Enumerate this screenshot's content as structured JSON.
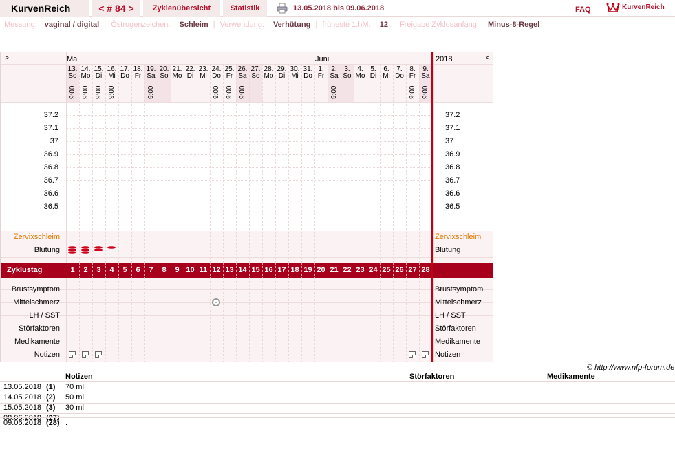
{
  "header": {
    "app_name": "KurvenReich",
    "cycle_label": "< # 84 >",
    "tab_overview": "Zyklenübersicht",
    "tab_statistics": "Statistik",
    "date_range": "13.05.2018 bis 09.06.2018",
    "faq": "FAQ",
    "logo_text": "KurvenReich"
  },
  "info": {
    "messung_label": "Messung:",
    "messung_value": "vaginal / digital",
    "oestrogen_label": "Östrogenzeichen:",
    "oestrogen_value": "Schleim",
    "verwendung_label": "Verwendung:",
    "verwendung_value": "Verhütung",
    "frueheste_label": "früheste 1.hM:",
    "frueheste_value": "12",
    "freigabe_label": "Freigabe Zyklusanfang:",
    "freigabe_value": "Minus-8-Regel"
  },
  "chart": {
    "nav_prev": ">",
    "nav_next": "<",
    "month_may": "Mai",
    "month_june": "Juni",
    "year": "2018",
    "days": [
      {
        "d": "13.",
        "w": "So",
        "t": "9:00",
        "we": true
      },
      {
        "d": "14.",
        "w": "Mo",
        "t": "9:00",
        "we": false
      },
      {
        "d": "15.",
        "w": "Di",
        "t": "9:00",
        "we": false
      },
      {
        "d": "16.",
        "w": "Mi",
        "t": "9:00",
        "we": false
      },
      {
        "d": "17.",
        "w": "Do",
        "t": "",
        "we": false
      },
      {
        "d": "18.",
        "w": "Fr",
        "t": "",
        "we": false
      },
      {
        "d": "19.",
        "w": "Sa",
        "t": "9:00",
        "we": true
      },
      {
        "d": "20.",
        "w": "So",
        "t": "",
        "we": true
      },
      {
        "d": "21.",
        "w": "Mo",
        "t": "",
        "we": false
      },
      {
        "d": "22.",
        "w": "Di",
        "t": "",
        "we": false
      },
      {
        "d": "23.",
        "w": "Mi",
        "t": "",
        "we": false
      },
      {
        "d": "24.",
        "w": "Do",
        "t": "9:00",
        "we": false
      },
      {
        "d": "25.",
        "w": "Fr",
        "t": "9:00",
        "we": false
      },
      {
        "d": "26.",
        "w": "Sa",
        "t": "9:00",
        "we": true
      },
      {
        "d": "27.",
        "w": "So",
        "t": "",
        "we": true
      },
      {
        "d": "28.",
        "w": "Mo",
        "t": "",
        "we": false
      },
      {
        "d": "29.",
        "w": "Di",
        "t": "",
        "we": false
      },
      {
        "d": "30.",
        "w": "Mi",
        "t": "",
        "we": false
      },
      {
        "d": "31.",
        "w": "Do",
        "t": "",
        "we": false
      },
      {
        "d": "1.",
        "w": "Fr",
        "t": "",
        "we": false
      },
      {
        "d": "2.",
        "w": "Sa",
        "t": "9:00",
        "we": true
      },
      {
        "d": "3.",
        "w": "So",
        "t": "",
        "we": true
      },
      {
        "d": "4.",
        "w": "Mo",
        "t": "",
        "we": false
      },
      {
        "d": "5.",
        "w": "Di",
        "t": "",
        "we": false
      },
      {
        "d": "6.",
        "w": "Mi",
        "t": "",
        "we": false
      },
      {
        "d": "7.",
        "w": "Do",
        "t": "",
        "we": false
      },
      {
        "d": "8.",
        "w": "Fr",
        "t": "9:00",
        "we": false
      },
      {
        "d": "9.",
        "w": "Sa",
        "t": "9:00",
        "we": true
      }
    ],
    "temps": [
      "37.2",
      "37.1",
      "37",
      "36.9",
      "36.8",
      "36.7",
      "36.6",
      "36.5"
    ],
    "rows": {
      "zervix": "Zervixschleim",
      "blutung": "Blutung",
      "zyklustag": "Zyklustag",
      "brust": "Brustsymptom",
      "mittel": "Mittelschmerz",
      "lh": "LH / SST",
      "stoer": "Störfaktoren",
      "medi": "Medikamente",
      "notizen": "Notizen"
    },
    "bleeding": [
      {
        "day": 1,
        "level": 3
      },
      {
        "day": 2,
        "level": 3
      },
      {
        "day": 3,
        "level": 2
      },
      {
        "day": 4,
        "level": 1
      }
    ],
    "mittelschmerz_day": 12,
    "notes_days": [
      1,
      2,
      3,
      27,
      28
    ],
    "colors": {
      "accent": "#a8001c",
      "zervix": "#e07800",
      "weekend": "#f3e3e6"
    }
  },
  "notes_table": {
    "copyright": "© http://www.nfp-forum.de",
    "headers": {
      "notizen": "Notizen",
      "stoer": "Störfaktoren",
      "medi": "Medikamente"
    },
    "rows": [
      {
        "date": "13.05.2018",
        "day": "(1)",
        "note": "70 ml"
      },
      {
        "date": "14.05.2018",
        "day": "(2)",
        "note": "50 ml"
      },
      {
        "date": "15.05.2018",
        "day": "(3)",
        "note": "30 ml"
      },
      {
        "date": "08.06.2018",
        "day": "(27)",
        "note": ""
      },
      {
        "date": "09.06.2018",
        "day": "(28)",
        "note": "."
      }
    ]
  }
}
